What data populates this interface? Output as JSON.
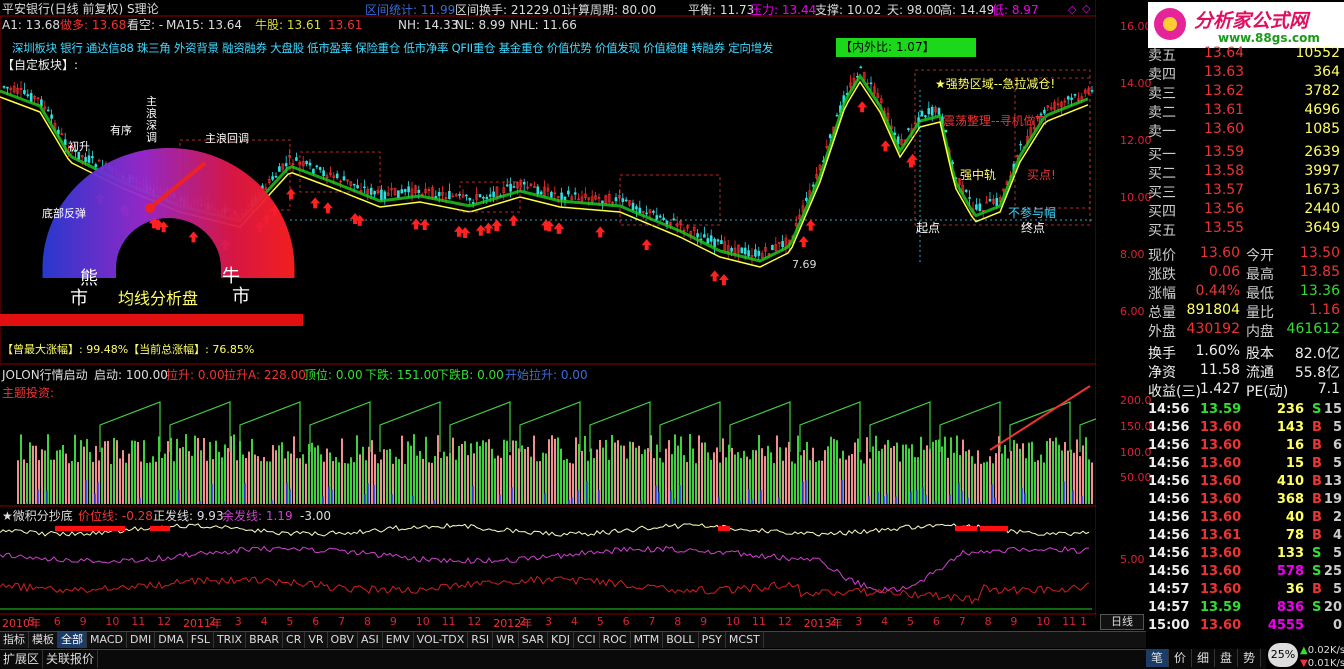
{
  "window": {
    "title": "平安银行(日线 前复权) S理论",
    "interval_stat": "区间统计: 11.99",
    "range_turnover": "区间换手: 21229.01",
    "calc_period": "计算周期: 80.00",
    "balance": "平衡: 11.73",
    "pressure_label": "压力: 13.44",
    "support_label": "支撑: 10.02",
    "sky": "天: 98.00",
    "high": "高: 14.49",
    "low": "低: 8.97"
  },
  "main_legend": {
    "a1": "A1: 13.68",
    "short": "做多: 13.68",
    "watch": "看空: -",
    "ma15": "MA15: 13.64",
    "bull": "牛股: 13.61",
    "bull2": "13.61",
    "nh": "NH: 14.33",
    "nl": "NL: 8.99",
    "nhl": "NHL: 11.66"
  },
  "sectors": "深圳板块 银行 通达信88 珠三角 外资背景 融资融券 大盘股 低市盈率 保险重仓 低市净率 QFII重仓 基金重仓 价值优势 价值发现 价值稳健 转融券 定向增发",
  "self_block": "【自定板块】:",
  "green_box": "【内外比: 1.07】",
  "gauge": {
    "title": "均线分析盘",
    "labels": [
      "底部反弹",
      "初升",
      "有序",
      "主浪深调",
      "主浪回调",
      "熊",
      "市",
      "牛",
      "市"
    ],
    "bottom": "【曾最大涨幅】: 99.48%【当前总涨幅】: 76.85%"
  },
  "annotations": {
    "strong": "★强势区域--急拉减仓!",
    "oscill": "震荡整理--寻机做T!",
    "mid": "强中轨",
    "buy_hint": "买点!",
    "not_join": "不参与帽",
    "start": "起点",
    "end": "终点",
    "low_price": "7.69",
    "buy": "买"
  },
  "main_y_ticks": [
    "16.00",
    "14.00",
    "12.00",
    "10.00",
    "8.00",
    "6.00"
  ],
  "ind1": {
    "legend_name": "JOLON行情启动",
    "start": "启动: 100.00",
    "lift": "拉升: 0.00",
    "liftA": "拉升A: 228.00",
    "top": "顶位: 0.00",
    "fall": "下跌: 151.00",
    "fallB": "下跌B: 0.00",
    "open_lift": "开始拉升: 0.00",
    "subtitle": "主题投资:",
    "y_ticks": [
      "200.0",
      "150.0",
      "100.0",
      "50.00"
    ]
  },
  "ind2": {
    "name": "★微积分抄底",
    "price": "价位线: -0.28",
    "pos": "正发线: 9.93",
    "rest": "余发线: 1.19",
    "dash": "-3.00",
    "y_tick": "5.00"
  },
  "date_axis": [
    "2010年",
    "5",
    "6",
    "9",
    "10",
    "11",
    "12",
    "2011年",
    "2",
    "3",
    "4",
    "5",
    "6",
    "7",
    "8",
    "9",
    "10",
    "11",
    "12",
    "2012年",
    "2",
    "3",
    "4",
    "5",
    "6",
    "7",
    "8",
    "9",
    "10",
    "11",
    "12",
    "2013年",
    "2",
    "3",
    "4",
    "5",
    "6",
    "7",
    "8",
    "9",
    "10",
    "11",
    "1"
  ],
  "day_line": "日线",
  "order_book": [
    {
      "label": "卖五",
      "price": "13.64",
      "vol": "10552"
    },
    {
      "label": "卖四",
      "price": "13.63",
      "vol": "364"
    },
    {
      "label": "卖三",
      "price": "13.62",
      "vol": "3782"
    },
    {
      "label": "卖二",
      "price": "13.61",
      "vol": "4696"
    },
    {
      "label": "卖一",
      "price": "13.60",
      "vol": "1085"
    },
    {
      "label": "买一",
      "price": "13.59",
      "vol": "2639"
    },
    {
      "label": "买二",
      "price": "13.58",
      "vol": "3997"
    },
    {
      "label": "买三",
      "price": "13.57",
      "vol": "1673"
    },
    {
      "label": "买四",
      "price": "13.56",
      "vol": "2440"
    },
    {
      "label": "买五",
      "price": "13.55",
      "vol": "3649"
    }
  ],
  "quote": [
    {
      "l1": "现价",
      "v1": "13.60",
      "l2": "今开",
      "v2": "13.50"
    },
    {
      "l1": "涨跌",
      "v1": "0.06",
      "l2": "最高",
      "v2": "13.85"
    },
    {
      "l1": "涨幅",
      "v1": "0.44%",
      "l2": "最低",
      "v2": "13.36"
    },
    {
      "l1": "总量",
      "v1": "891804",
      "l2": "量比",
      "v2": "1.16"
    },
    {
      "l1": "外盘",
      "v1": "430192",
      "l2": "内盘",
      "v2": "461612"
    }
  ],
  "fund": [
    {
      "l1": "换手",
      "v1": "1.60%",
      "l2": "股本",
      "v2": "82.0亿"
    },
    {
      "l1": "净资",
      "v1": "11.58",
      "l2": "流通",
      "v2": "55.8亿"
    },
    {
      "l1": "收益(三)",
      "v1": "1.427",
      "l2": "PE(动)",
      "v2": "7.1"
    }
  ],
  "ticks": [
    {
      "t": "14:56",
      "p": "13.59",
      "v": "236",
      "s": "S",
      "n": "15"
    },
    {
      "t": "14:56",
      "p": "13.60",
      "v": "143",
      "s": "B",
      "n": "5"
    },
    {
      "t": "14:56",
      "p": "13.60",
      "v": "16",
      "s": "B",
      "n": "6"
    },
    {
      "t": "14:56",
      "p": "13.60",
      "v": "15",
      "s": "B",
      "n": "5"
    },
    {
      "t": "14:56",
      "p": "13.60",
      "v": "410",
      "s": "B",
      "n": "13"
    },
    {
      "t": "14:56",
      "p": "13.60",
      "v": "368",
      "s": "B",
      "n": "19"
    },
    {
      "t": "14:56",
      "p": "13.60",
      "v": "40",
      "s": "B",
      "n": "2"
    },
    {
      "t": "14:56",
      "p": "13.61",
      "v": "78",
      "s": "B",
      "n": "4"
    },
    {
      "t": "14:56",
      "p": "13.60",
      "v": "133",
      "s": "S",
      "n": "5"
    },
    {
      "t": "14:56",
      "p": "13.60",
      "v": "578",
      "s": "S",
      "n": "25"
    },
    {
      "t": "14:57",
      "p": "13.60",
      "v": "36",
      "s": "B",
      "n": "5"
    },
    {
      "t": "14:57",
      "p": "13.59",
      "v": "836",
      "s": "S",
      "n": "20"
    },
    {
      "t": "15:00",
      "p": "13.60",
      "v": "4555",
      "s": "",
      "n": "0"
    }
  ],
  "tabs": [
    "指标",
    "模板",
    "全部",
    "MACD",
    "DMI",
    "DMA",
    "FSL",
    "TRIX",
    "BRAR",
    "CR",
    "VR",
    "OBV",
    "ASI",
    "EMV",
    "VOL-TDX",
    "RSI",
    "WR",
    "SAR",
    "KDJ",
    "CCI",
    "ROC",
    "MTM",
    "BOLL",
    "PSY",
    "MCST"
  ],
  "tabs2": [
    "扩展区",
    "关联报价"
  ],
  "rp_tabs": [
    "笔",
    "价",
    "细",
    "盘",
    "势"
  ],
  "net": {
    "pct": "25%",
    "up": "0.02K/s",
    "down": "0.01K/s"
  },
  "logo": {
    "title": "分析家公式网",
    "url": "www.88gs.com"
  },
  "zoom": {
    "plus": "+",
    "minus": "-",
    "zero": "0"
  }
}
